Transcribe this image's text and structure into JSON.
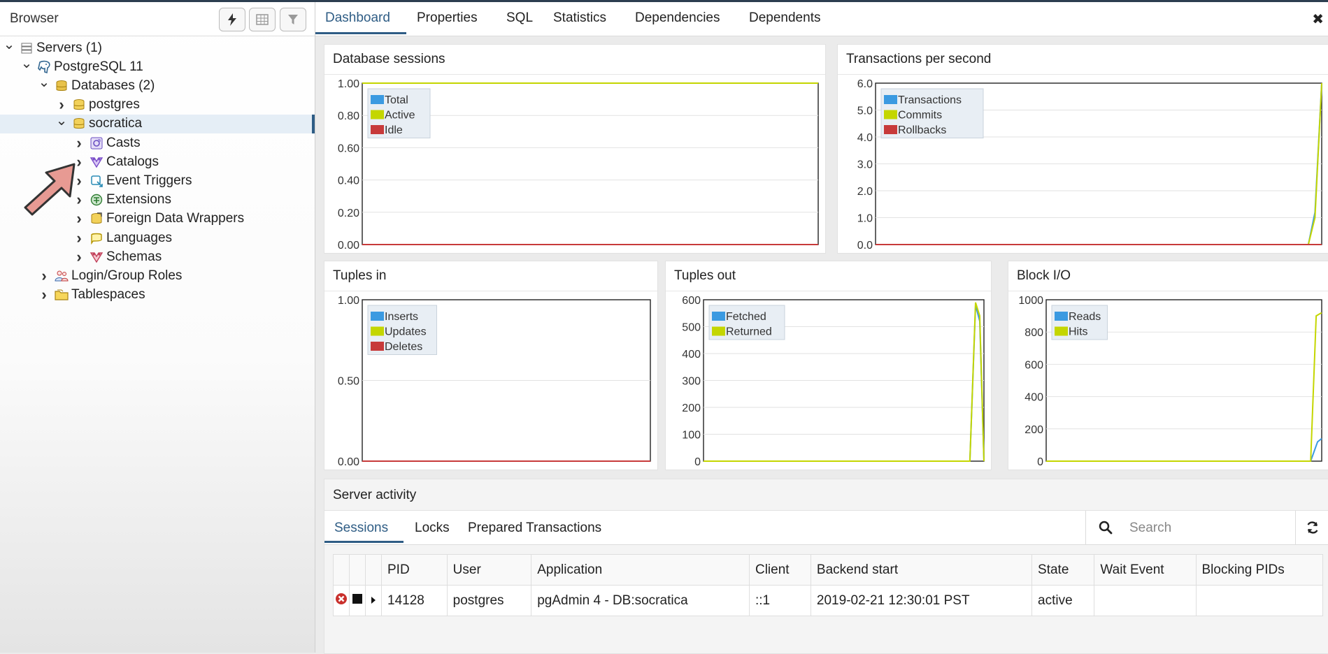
{
  "sidebar": {
    "title": "Browser",
    "tree": [
      {
        "label": "Servers (1)",
        "level": 0,
        "expanded": true,
        "icon": "servers-icon"
      },
      {
        "label": "PostgreSQL 11",
        "level": 1,
        "expanded": true,
        "icon": "postgresql-elephant-icon"
      },
      {
        "label": "Databases (2)",
        "level": 2,
        "expanded": true,
        "icon": "databases-icon"
      },
      {
        "label": "postgres",
        "level": 3,
        "expanded": false,
        "icon": "database-icon"
      },
      {
        "label": "socratica",
        "level": 3,
        "expanded": true,
        "icon": "database-icon",
        "selected": true
      },
      {
        "label": "Casts",
        "level": 4,
        "expanded": false,
        "icon": "casts-icon"
      },
      {
        "label": "Catalogs",
        "level": 4,
        "expanded": false,
        "icon": "catalogs-icon"
      },
      {
        "label": "Event Triggers",
        "level": 4,
        "expanded": false,
        "icon": "event-triggers-icon"
      },
      {
        "label": "Extensions",
        "level": 4,
        "expanded": false,
        "icon": "extensions-icon"
      },
      {
        "label": "Foreign Data Wrappers",
        "level": 4,
        "expanded": false,
        "icon": "foreign-data-wrappers-icon"
      },
      {
        "label": "Languages",
        "level": 4,
        "expanded": false,
        "icon": "languages-icon"
      },
      {
        "label": "Schemas",
        "level": 4,
        "expanded": false,
        "icon": "schemas-icon"
      },
      {
        "label": "Login/Group Roles",
        "level": 2,
        "expanded": false,
        "icon": "login-roles-icon"
      },
      {
        "label": "Tablespaces",
        "level": 2,
        "expanded": false,
        "icon": "tablespaces-icon"
      }
    ]
  },
  "tabs": [
    "Dashboard",
    "Properties",
    "SQL",
    "Statistics",
    "Dependencies",
    "Dependents"
  ],
  "active_tab": "Dashboard",
  "chart_data": [
    {
      "type": "line",
      "title": "Database sessions",
      "ylim": [
        0,
        1
      ],
      "yticks": [
        "0.00",
        "0.20",
        "0.40",
        "0.60",
        "0.80",
        "1.00"
      ],
      "series": [
        {
          "name": "Total",
          "color": "#3b9ae1",
          "points": [
            [
              0,
              0
            ],
            [
              0.99,
              0
            ],
            [
              1,
              0
            ]
          ]
        },
        {
          "name": "Active",
          "color": "#c4d600",
          "points": [
            [
              0,
              1
            ],
            [
              0.99,
              1
            ],
            [
              1,
              1
            ]
          ]
        },
        {
          "name": "Idle",
          "color": "#c73a3a",
          "points": [
            [
              0,
              0
            ],
            [
              0.95,
              0
            ],
            [
              1,
              0
            ]
          ]
        }
      ]
    },
    {
      "type": "line",
      "title": "Transactions per second",
      "ylim": [
        0,
        6
      ],
      "yticks": [
        "0.0",
        "1.0",
        "2.0",
        "3.0",
        "4.0",
        "5.0",
        "6.0"
      ],
      "series": [
        {
          "name": "Transactions",
          "color": "#3b9ae1",
          "points": [
            [
              0,
              0
            ],
            [
              0.97,
              0
            ],
            [
              0.985,
              1.2
            ],
            [
              1,
              6
            ]
          ]
        },
        {
          "name": "Commits",
          "color": "#c4d600",
          "points": [
            [
              0,
              0
            ],
            [
              0.97,
              0
            ],
            [
              0.985,
              1.0
            ],
            [
              1,
              6
            ]
          ]
        },
        {
          "name": "Rollbacks",
          "color": "#c73a3a",
          "points": [
            [
              0,
              0
            ],
            [
              1,
              0
            ]
          ]
        }
      ]
    },
    {
      "type": "line",
      "title": "Tuples in",
      "ylim": [
        0,
        1
      ],
      "yticks": [
        "0.00",
        "0.50",
        "1.00"
      ],
      "series": [
        {
          "name": "Inserts",
          "color": "#3b9ae1",
          "points": [
            [
              0,
              0
            ],
            [
              1,
              0
            ]
          ]
        },
        {
          "name": "Updates",
          "color": "#c4d600",
          "points": [
            [
              0,
              0
            ],
            [
              1,
              0
            ]
          ]
        },
        {
          "name": "Deletes",
          "color": "#c73a3a",
          "points": [
            [
              0,
              0
            ],
            [
              0.96,
              0
            ],
            [
              1,
              0
            ]
          ]
        }
      ]
    },
    {
      "type": "line",
      "title": "Tuples out",
      "ylim": [
        0,
        600
      ],
      "yticks": [
        "0",
        "100",
        "200",
        "300",
        "400",
        "500",
        "600"
      ],
      "series": [
        {
          "name": "Fetched",
          "color": "#3b9ae1",
          "points": [
            [
              0,
              0
            ],
            [
              0.95,
              0
            ],
            [
              0.97,
              580
            ],
            [
              0.985,
              520
            ],
            [
              1,
              0
            ]
          ]
        },
        {
          "name": "Returned",
          "color": "#c4d600",
          "points": [
            [
              0,
              0
            ],
            [
              0.95,
              0
            ],
            [
              0.97,
              590
            ],
            [
              0.985,
              540
            ],
            [
              1,
              0
            ]
          ]
        }
      ]
    },
    {
      "type": "line",
      "title": "Block I/O",
      "ylim": [
        0,
        1000
      ],
      "yticks": [
        "0",
        "200",
        "400",
        "600",
        "800",
        "1000"
      ],
      "series": [
        {
          "name": "Reads",
          "color": "#3b9ae1",
          "points": [
            [
              0,
              0
            ],
            [
              0.96,
              0
            ],
            [
              0.985,
              120
            ],
            [
              1,
              140
            ]
          ]
        },
        {
          "name": "Hits",
          "color": "#c4d600",
          "points": [
            [
              0,
              0
            ],
            [
              0.96,
              0
            ],
            [
              0.98,
              900
            ],
            [
              1,
              920
            ]
          ]
        }
      ]
    }
  ],
  "activity": {
    "title": "Server activity",
    "tabs": [
      "Sessions",
      "Locks",
      "Prepared Transactions"
    ],
    "active_tab": "Sessions",
    "search_placeholder": "Search",
    "columns": [
      "PID",
      "User",
      "Application",
      "Client",
      "Backend start",
      "State",
      "Wait Event",
      "Blocking PIDs"
    ],
    "rows": [
      {
        "pid": "14128",
        "user": "postgres",
        "application": "pgAdmin 4 - DB:socratica",
        "client": "::1",
        "backend_start": "2019-02-21 12:30:01 PST",
        "state": "active",
        "wait_event": "",
        "blocking_pids": ""
      }
    ]
  }
}
